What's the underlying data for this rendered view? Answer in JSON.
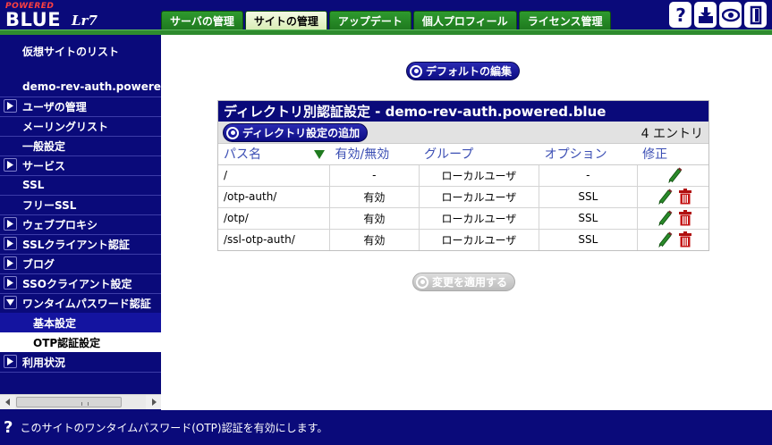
{
  "logo": {
    "small": "POWERED",
    "big": "BLUE",
    "script": "Lr7"
  },
  "tabs": [
    {
      "label": "サーバの管理",
      "active": false
    },
    {
      "label": "サイトの管理",
      "active": true
    },
    {
      "label": "アップデート",
      "active": false
    },
    {
      "label": "個人プロフィール",
      "active": false
    },
    {
      "label": "ライセンス管理",
      "active": false
    }
  ],
  "header_icons": [
    "help-icon",
    "import-icon",
    "view-icon",
    "logout-icon"
  ],
  "sidebar": {
    "items": [
      {
        "label": "仮想サイトのリスト",
        "arrow": false
      },
      {
        "label": "demo-rev-auth.powered.blue",
        "arrow": false
      },
      {
        "label": "ユーザの管理",
        "arrow": true
      },
      {
        "label": "メーリングリスト",
        "arrow": false
      },
      {
        "label": "一般設定",
        "arrow": false
      },
      {
        "label": "サービス",
        "arrow": true
      },
      {
        "label": "SSL",
        "arrow": false
      },
      {
        "label": "フリーSSL",
        "arrow": false
      },
      {
        "label": "ウェブプロキシ",
        "arrow": true
      },
      {
        "label": "SSLクライアント認証",
        "arrow": true
      },
      {
        "label": "ブログ",
        "arrow": true
      },
      {
        "label": "SSOクライアント設定",
        "arrow": true
      },
      {
        "label": "ワンタイムパスワード認証",
        "arrow": true,
        "expanded": true
      },
      {
        "label": "基本設定",
        "sub": true
      },
      {
        "label": "OTP認証設定",
        "sub": true,
        "selected": true
      },
      {
        "label": "利用状況",
        "arrow": true
      }
    ]
  },
  "main": {
    "default_edit_button": "デフォルトの編集",
    "panel_title": "ディレクトリ別認証設定 - demo-rev-auth.powered.blue",
    "add_button": "ディレクトリ設定の追加",
    "entries": "4 エントリ",
    "columns": [
      "パス名",
      "有効/無効",
      "グループ",
      "オプション",
      "修正"
    ],
    "rows": [
      {
        "path": "/",
        "enabled": "-",
        "group": "ローカルユーザ",
        "option": "-",
        "deletable": false
      },
      {
        "path": "/otp-auth/",
        "enabled": "有効",
        "group": "ローカルユーザ",
        "option": "SSL",
        "deletable": true
      },
      {
        "path": "/otp/",
        "enabled": "有効",
        "group": "ローカルユーザ",
        "option": "SSL",
        "deletable": true
      },
      {
        "path": "/ssl-otp-auth/",
        "enabled": "有効",
        "group": "ローカルユーザ",
        "option": "SSL",
        "deletable": true
      }
    ],
    "apply_button": "変更を適用する"
  },
  "status": {
    "text": "このサイトのワンタイムパスワード(OTP)認証を有効にします。"
  },
  "colors": {
    "navy": "#0a0a7a",
    "tab_green": "#2e9a2e",
    "header_text": "#3b4eb4"
  }
}
